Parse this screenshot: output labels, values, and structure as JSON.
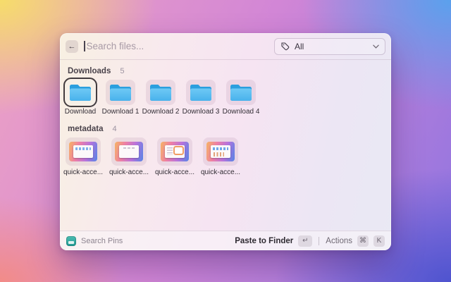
{
  "app": {
    "search": {
      "placeholder": "Search files...",
      "back_label": "←"
    },
    "filter": {
      "selected": "All"
    },
    "sections": {
      "downloads": {
        "title": "Downloads",
        "count": "5",
        "items": [
          "Download",
          "Download 1",
          "Download 2",
          "Download 3",
          "Download 4"
        ]
      },
      "metadata": {
        "title": "metadata",
        "count": "4",
        "items": [
          "quick-acce...",
          "quick-acce...",
          "quick-acce...",
          "quick-acce..."
        ]
      }
    },
    "footer": {
      "app_name": "Search Pins",
      "primary_action": "Paste to Finder",
      "primary_shortcut": "↵",
      "secondary_action": "Actions",
      "secondary_shortcut_1": "⌘",
      "secondary_shortcut_2": "K"
    },
    "colors": {
      "folder_blue": "#4db8ef",
      "app_icon_teal": "#2fa9a0",
      "selection_border": "#423c3f",
      "background_corners": [
        "#f6dd6a",
        "#56a3ee",
        "#4f54cf",
        "#f48a80"
      ]
    }
  }
}
